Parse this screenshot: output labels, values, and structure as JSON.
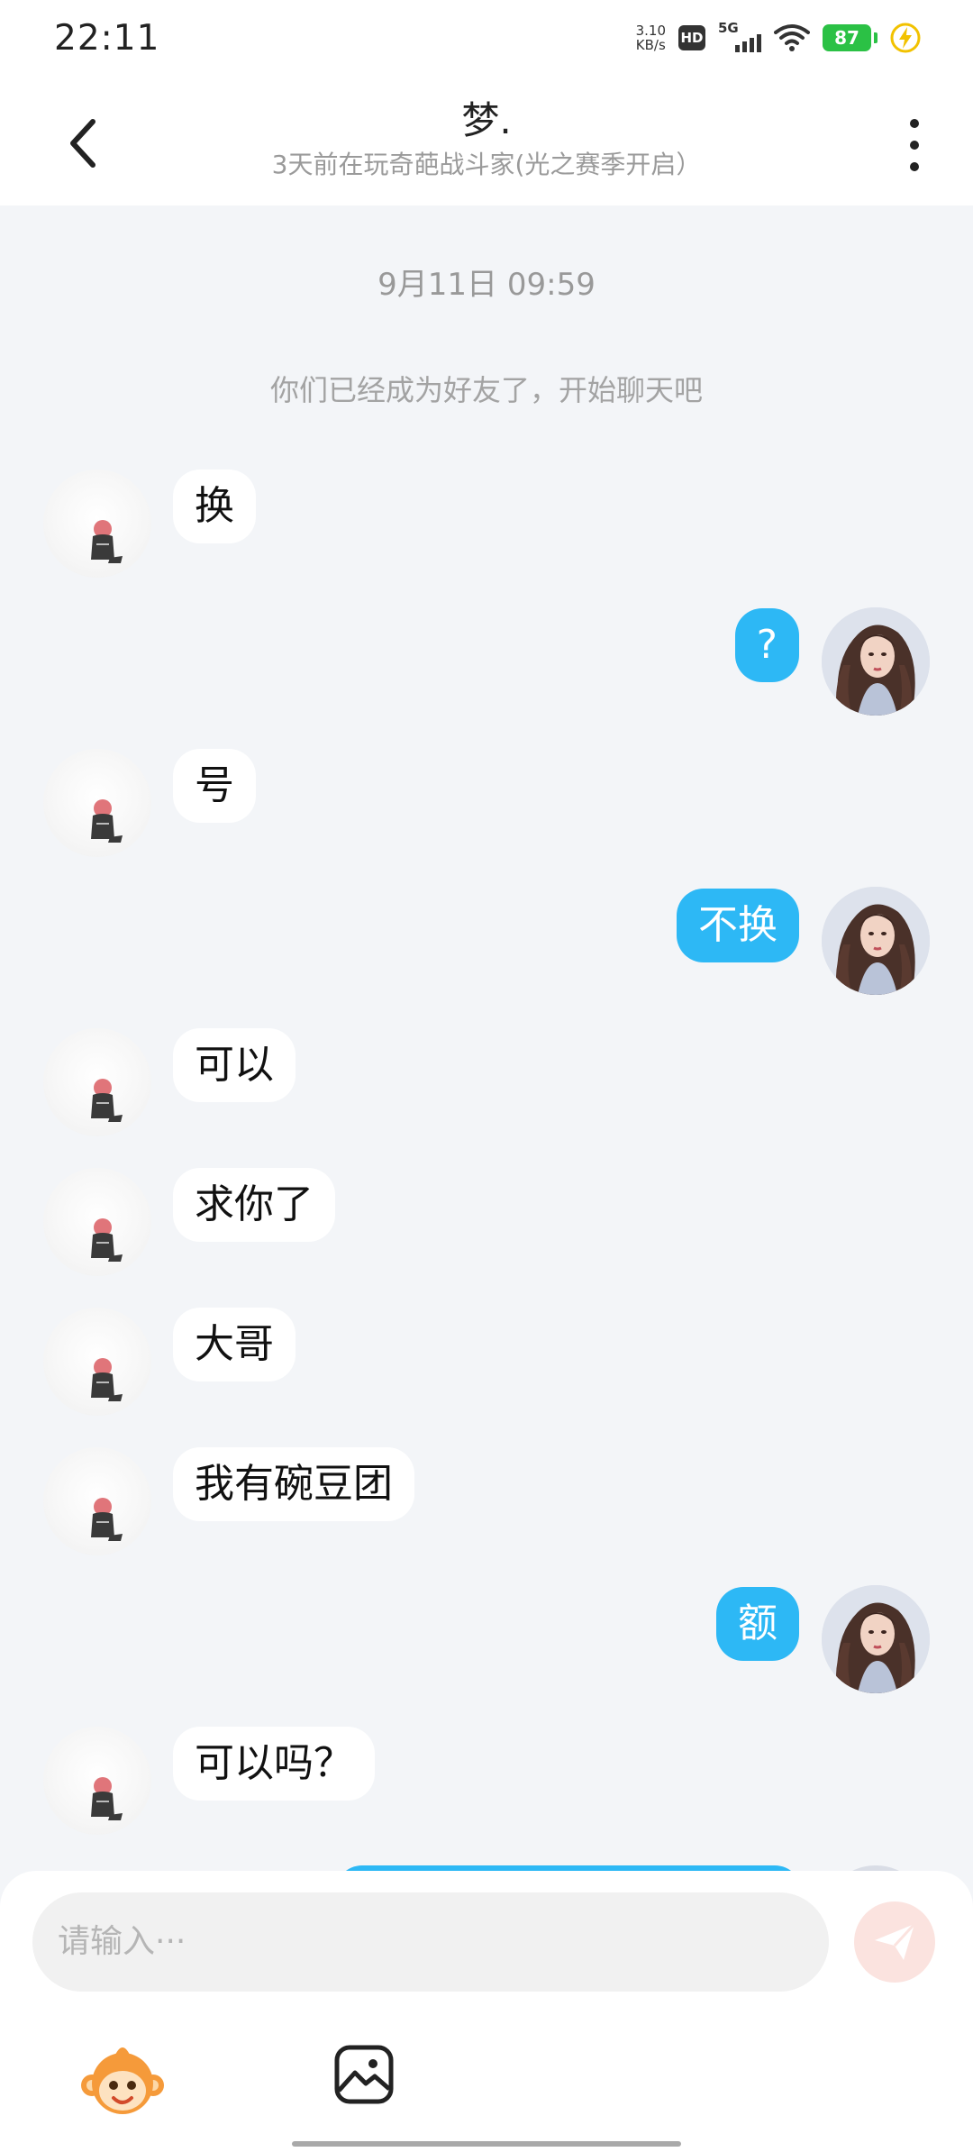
{
  "status_bar": {
    "time": "22:11",
    "net_speed_value": "3.10",
    "net_speed_unit": "KB/s",
    "hd": "HD",
    "signal": "5G",
    "battery": "87"
  },
  "header": {
    "title": "梦.",
    "subtitle": "3天前在玩奇葩战斗家(光之赛季开启）"
  },
  "chat": {
    "timestamp": "9月11日  09:59",
    "system_notice": "你们已经成为好友了，开始聊天吧",
    "messages": [
      {
        "sender": "them",
        "text": "换"
      },
      {
        "sender": "me",
        "text": "?"
      },
      {
        "sender": "them",
        "text": "号"
      },
      {
        "sender": "me",
        "text": "不换"
      },
      {
        "sender": "them",
        "text": "可以"
      },
      {
        "sender": "them",
        "text": "求你了"
      },
      {
        "sender": "them",
        "text": "大哥"
      },
      {
        "sender": "them",
        "text": "我有碗豆团"
      },
      {
        "sender": "me",
        "text": "额"
      },
      {
        "sender": "them",
        "text": "可以吗？"
      }
    ]
  },
  "input": {
    "placeholder": "请输入···"
  },
  "colors": {
    "my_bubble": "#2db8f5",
    "their_bubble": "#ffffff",
    "send_button": "#fbe3df",
    "chat_background": "#f3f5f8"
  }
}
